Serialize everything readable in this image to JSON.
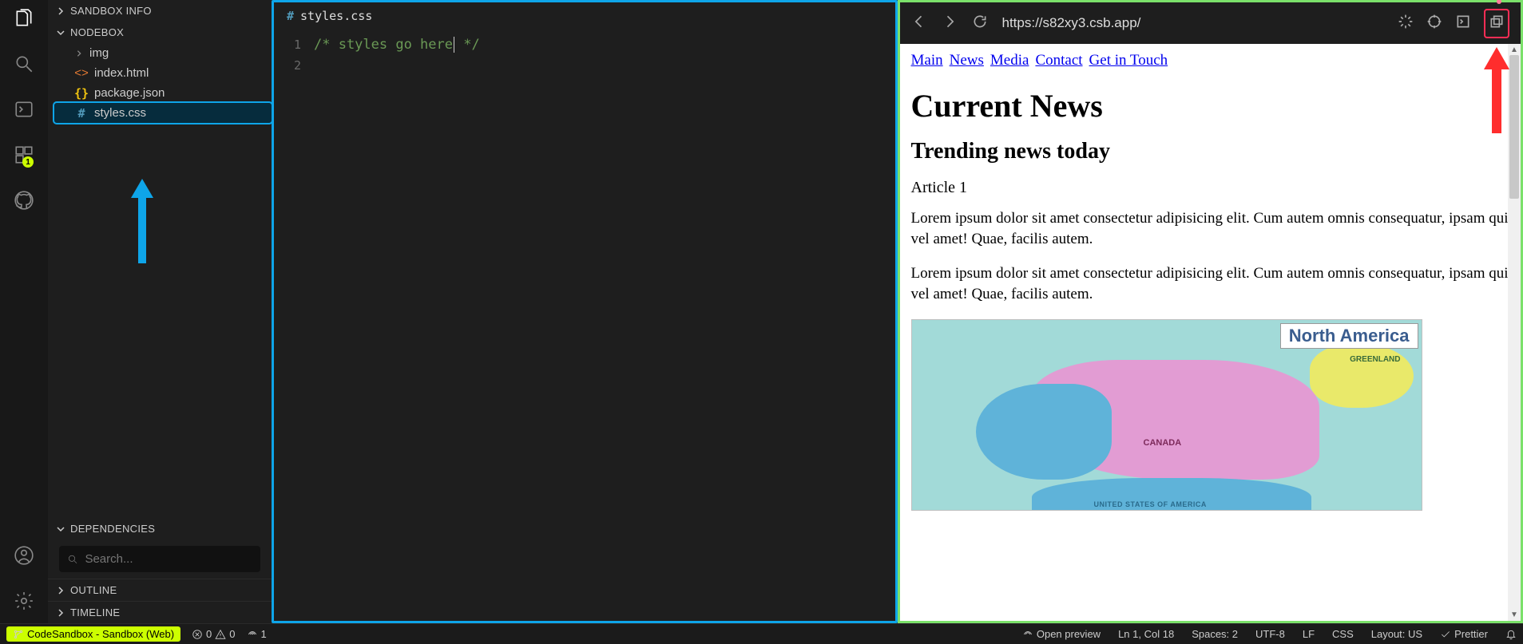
{
  "sidebar": {
    "sections": {
      "sandboxInfo": "SANDBOX INFO",
      "nodebox": "NODEBOX",
      "dependencies": "DEPENDENCIES",
      "outline": "OUTLINE",
      "timeline": "TIMELINE"
    },
    "files": {
      "img": "img",
      "indexHtml": "index.html",
      "packageJson": "package.json",
      "stylesCss": "styles.css"
    },
    "searchPlaceholder": "Search..."
  },
  "activityBadge": "1",
  "editor": {
    "tabLabel": "styles.css",
    "lines": {
      "n1": "1",
      "n2": "2",
      "l1a": "/* styles go here",
      "l1b": " */"
    }
  },
  "preview": {
    "url": "https://s82xy3.csb.app/",
    "nav": {
      "main": "Main",
      "news": "News",
      "media": "Media",
      "contact": "Contact",
      "getInTouch": "Get in Touch"
    },
    "h1": "Current News",
    "h2": "Trending news today",
    "article1": "Article 1",
    "para": "Lorem ipsum dolor sit amet consectetur adipisicing elit. Cum autem omnis consequatur, ipsam qui vel amet! Quae, facilis autem.",
    "map": {
      "title": "North America",
      "greenland": "GREENLAND",
      "canada": "CANADA",
      "usa": "UNITED STATES OF AMERICA"
    }
  },
  "status": {
    "branch": "CodeSandbox - Sandbox (Web)",
    "errors": "0",
    "warnings": "0",
    "ports": "1",
    "openPreview": "Open preview",
    "lnCol": "Ln 1, Col 18",
    "spaces": "Spaces: 2",
    "encoding": "UTF-8",
    "eol": "LF",
    "lang": "CSS",
    "layout": "Layout: US",
    "prettier": "Prettier"
  }
}
